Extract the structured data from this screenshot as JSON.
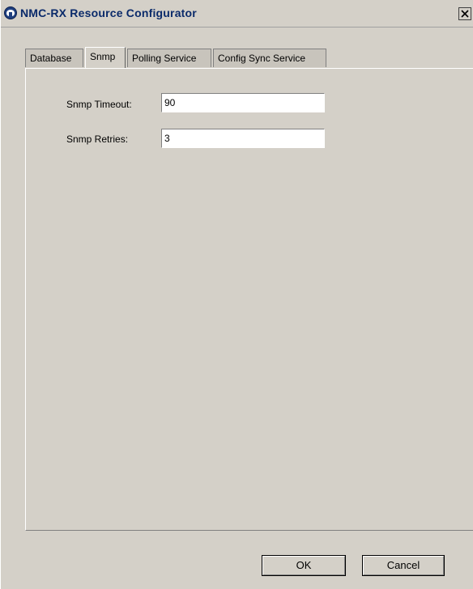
{
  "window": {
    "title": "NMC-RX Resource Configurator"
  },
  "tabs": [
    {
      "label": "Database",
      "active": false
    },
    {
      "label": "Snmp",
      "active": true
    },
    {
      "label": "Polling Service",
      "active": false
    },
    {
      "label": "Config Sync Service",
      "active": false
    }
  ],
  "snmp": {
    "timeout_label": "Snmp Timeout:",
    "timeout_value": "90",
    "retries_label": "Snmp Retries:",
    "retries_value": "3"
  },
  "buttons": {
    "ok_label": "OK",
    "cancel_label": "Cancel"
  },
  "icons": {
    "app": "app-logo-icon",
    "close": "close-icon"
  },
  "colors": {
    "dialog_bg": "#d4d0c8",
    "title_text": "#0a2a6a"
  }
}
